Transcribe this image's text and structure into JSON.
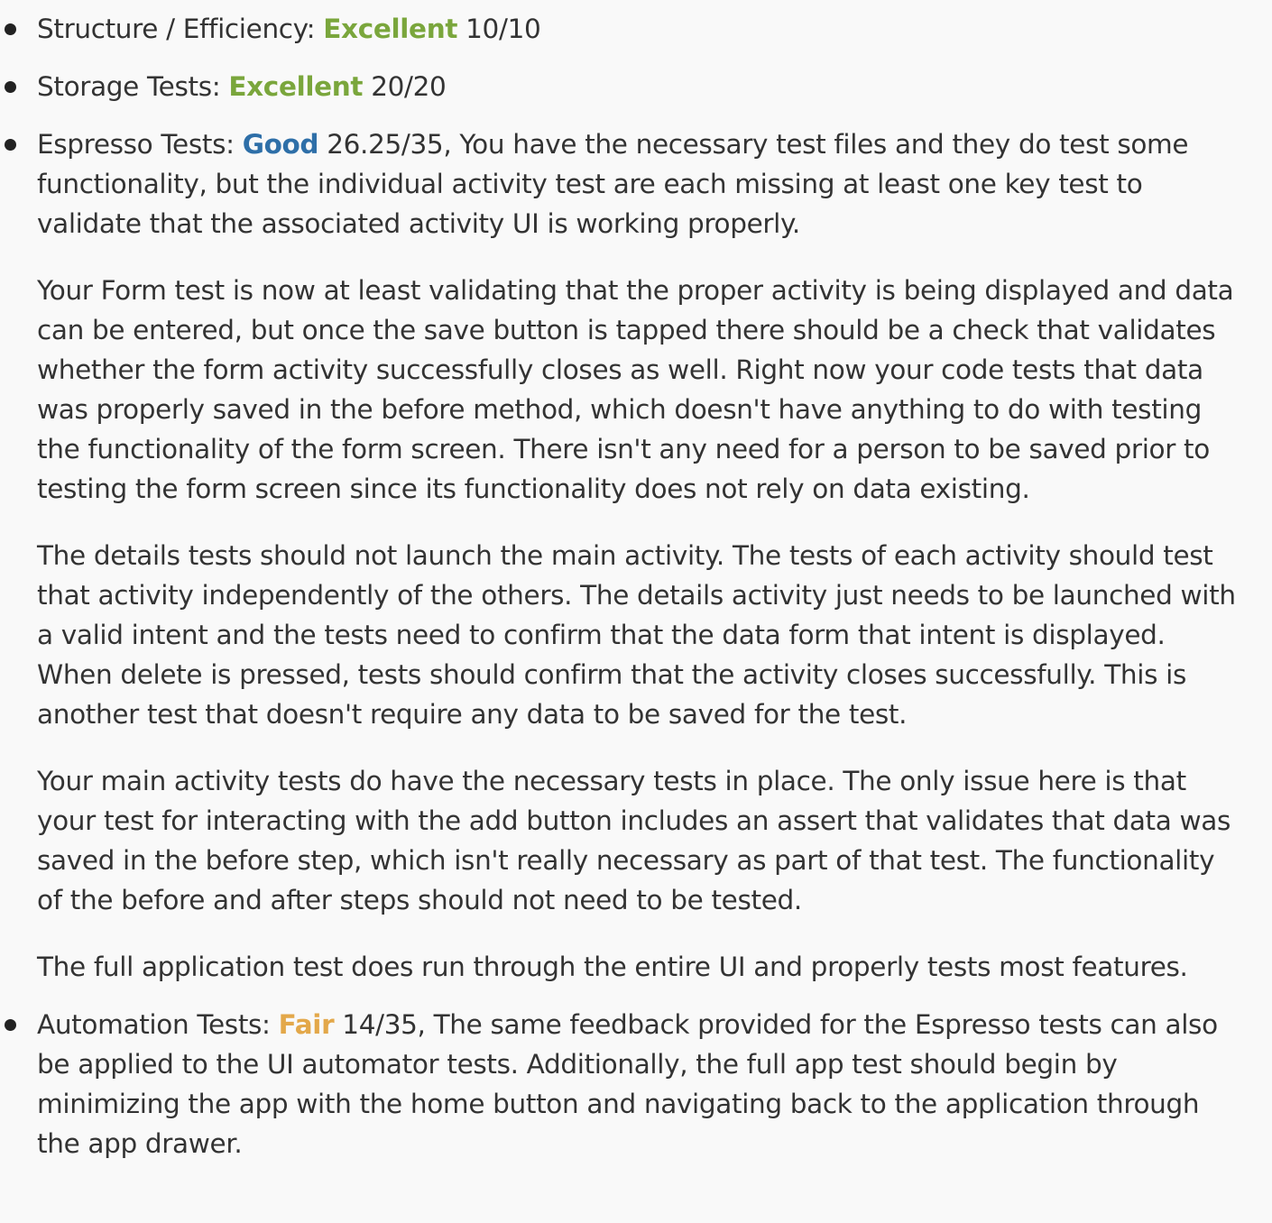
{
  "colors": {
    "excellent": "#7aa63c",
    "good": "#2e6fa8",
    "fair": "#e3a84a",
    "text": "#333333",
    "background": "#f9f9f9"
  },
  "items": [
    {
      "label": "Structure / Efficiency: ",
      "rating": "Excellent",
      "score": " 10/10"
    },
    {
      "label": "Storage Tests: ",
      "rating": "Excellent",
      "score": " 20/20"
    },
    {
      "label": "Espresso Tests: ",
      "rating": "Good",
      "score": " 26.25/35, You have the necessary test files and they do test some functionality, but the individual activity test are each missing at least one key test to validate that the associated activity UI is working properly.",
      "paragraphs": [
        "Your Form test is now at least validating that the proper activity is being displayed and data can be entered, but once the save button is tapped there should be a check that validates whether the form activity successfully closes as well. Right now your code tests that data was properly saved in the before method, which doesn't have anything to do with testing the functionality of the form screen. There isn't any need for a person to be saved prior to testing the form screen since its functionality does not rely on data existing.",
        "The details tests should not launch the main activity. The tests of each activity should test that activity independently of the others. The details activity just needs to be launched with a valid intent and the tests need to confirm that the data form that intent is displayed. When delete is pressed, tests should confirm that the activity closes successfully. This is another test that doesn't require any data to be saved for the test.",
        "Your main activity tests do have the necessary tests in place. The only issue here is that your test for interacting with the add button includes an assert that validates that data was saved in the before step, which isn't really necessary as part of that test. The functionality of the before and after steps should not need to be tested.",
        "The full application test does run through the entire UI and properly tests most features."
      ]
    },
    {
      "label": "Automation Tests: ",
      "rating": "Fair",
      "score": " 14/35, The same feedback provided for the Espresso tests can also be applied to the UI automator tests. Additionally, the full app test should begin by minimizing the app with the home button and navigating back to the application through the app drawer."
    }
  ]
}
